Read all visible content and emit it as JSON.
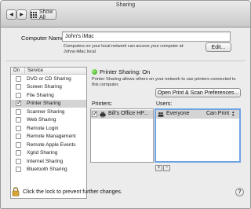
{
  "window": {
    "title": "Sharing"
  },
  "toolbar": {
    "back_glyph": "◀",
    "forward_glyph": "▶",
    "show_all_label": "Show All"
  },
  "computer_name": {
    "label": "Computer Name:",
    "value": "John's iMac",
    "hint_line1": "Computers on your local network can access your computer at:",
    "hint_line2": "Johns-iMac.local",
    "edit_label": "Edit..."
  },
  "services": {
    "col_on": "On",
    "col_service": "Service",
    "items": [
      {
        "label": "DVD or CD Sharing",
        "on": false
      },
      {
        "label": "Screen Sharing",
        "on": false
      },
      {
        "label": "File Sharing",
        "on": false
      },
      {
        "label": "Printer Sharing",
        "on": true,
        "selected": true
      },
      {
        "label": "Scanner Sharing",
        "on": false
      },
      {
        "label": "Web Sharing",
        "on": false
      },
      {
        "label": "Remote Login",
        "on": false
      },
      {
        "label": "Remote Management",
        "on": false
      },
      {
        "label": "Remote Apple Events",
        "on": false
      },
      {
        "label": "Xgrid Sharing",
        "on": false
      },
      {
        "label": "Internet Sharing",
        "on": false
      },
      {
        "label": "Bluetooth Sharing",
        "on": false
      }
    ]
  },
  "detail": {
    "status_text": "Printer Sharing: On",
    "status_color": "#2c9c12",
    "description_line1": "Printer Sharing allows others on your network to use printers connected to",
    "description_line2": "this computer.",
    "open_prefs_label": "Open Print & Scan Preferences...",
    "printers_label": "Printers:",
    "printer_name": "Bill's Office HP...",
    "users_label": "Users:",
    "user_name": "Everyone",
    "user_permission": "Can Print",
    "add_label": "+",
    "remove_label": "−"
  },
  "footer": {
    "lock_text": "Click the lock to prevent further changes.",
    "help_label": "?"
  },
  "icons": [
    "back-arrow-icon",
    "forward-arrow-icon",
    "grid-icon",
    "status-dot-icon",
    "printer-icon",
    "users-group-icon",
    "permission-arrows-icon",
    "lock-icon",
    "help-icon"
  ],
  "colors": {
    "selection": "#d4d4d4",
    "status_green": "#2c9c12"
  }
}
